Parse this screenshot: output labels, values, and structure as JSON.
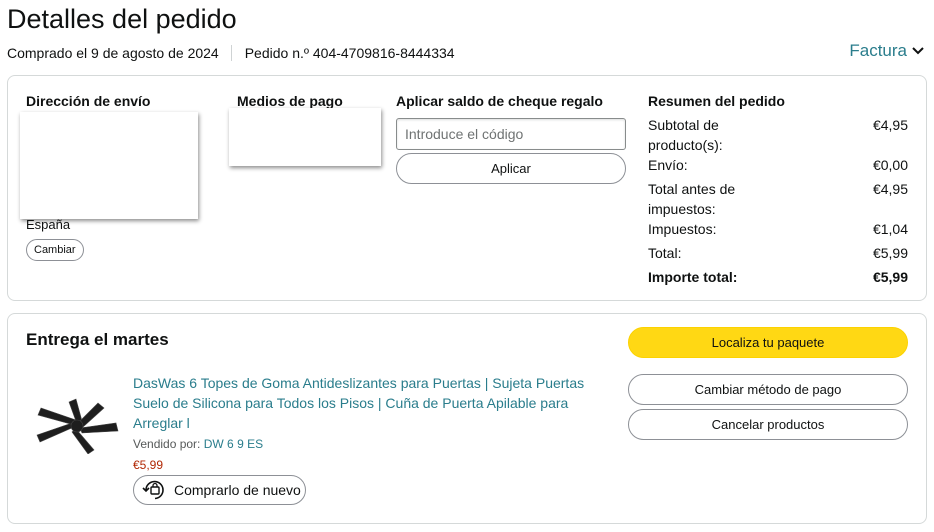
{
  "header": {
    "title": "Detalles del pedido",
    "purchase_date": "Comprado el 9 de agosto de 2024",
    "order_number": "Pedido n.º 404-4709816-8444334",
    "invoice_label": "Factura"
  },
  "shipping": {
    "title": "Dirección de envío",
    "country": "España",
    "change_label": "Cambiar"
  },
  "payment": {
    "title": "Medios de pago"
  },
  "gift": {
    "title": "Aplicar saldo de cheque regalo",
    "placeholder": "Introduce el código",
    "apply_label": "Aplicar"
  },
  "summary": {
    "title": "Resumen del pedido",
    "rows": [
      {
        "label": "Subtotal de producto(s):",
        "value": "€4,95"
      },
      {
        "label": "Envío:",
        "value": "€0,00"
      },
      {
        "label": "Total antes de impuestos:",
        "value": "€4,95"
      },
      {
        "label": "Impuestos:",
        "value": "€1,04"
      },
      {
        "label": "Total:",
        "value": "€5,99"
      }
    ],
    "grand_total_label": "Importe total:",
    "grand_total_value": "€5,99"
  },
  "delivery": {
    "heading": "Entrega el martes",
    "track_label": "Localiza tu paquete",
    "change_payment_label": "Cambiar método de pago",
    "cancel_label": "Cancelar productos",
    "product": {
      "title": "DasWas 6 Topes de Goma Antideslizantes para Puertas | Sujeta Puertas Suelo de Silicona para Todos los Pisos | Cuña de Puerta Apilable para Arreglar l",
      "seller_prefix": "Vendido por:",
      "seller_name": "DW 6 9 ES",
      "price": "€5,99",
      "buy_again_label": "Comprarlo de nuevo"
    }
  },
  "colors": {
    "link": "#2a7d8c",
    "price": "#b12704",
    "primary_button": "#ffd814"
  },
  "icons": [
    "chevron-down-icon",
    "buy-again-icon"
  ]
}
